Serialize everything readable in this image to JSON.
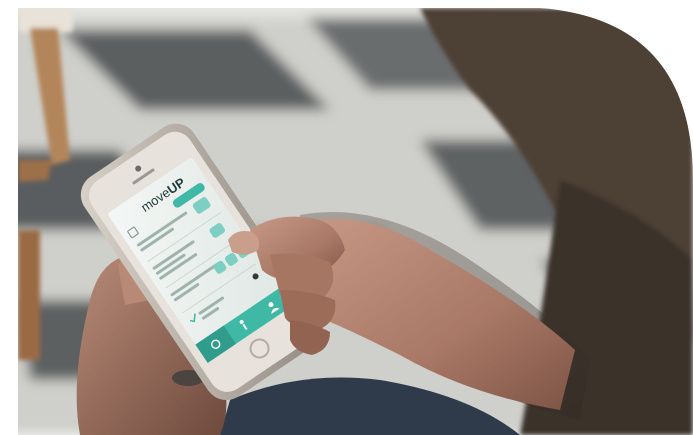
{
  "app": {
    "logo_prefix": "move",
    "logo_suffix": "UP"
  },
  "colors": {
    "brand_teal": "#3fb8a6",
    "brand_teal_dark": "#2f9c8c",
    "screen_bg": "#eef3f1",
    "rug_dark": "#5c5f60",
    "rug_light": "#d9d9d6"
  },
  "icons": {
    "tab_left": "home-icon",
    "tab_middle": "figure-icon",
    "tab_right": "profile-icon"
  }
}
